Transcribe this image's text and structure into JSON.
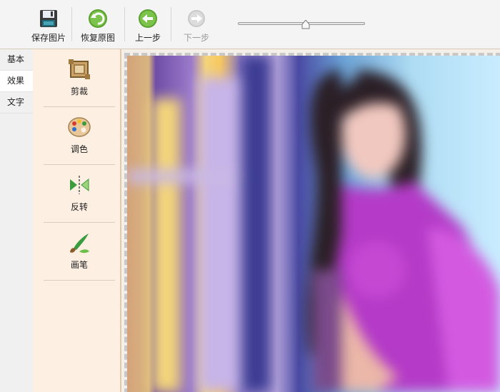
{
  "toolbar": {
    "save_label": "保存图片",
    "restore_label": "恢复原图",
    "undo_label": "上一步",
    "redo_label": "下一步",
    "slider_value": 0.5
  },
  "side_tabs": [
    {
      "label": "基本"
    },
    {
      "label": "效果"
    },
    {
      "label": "文字"
    }
  ],
  "tools": [
    {
      "label": "剪裁",
      "icon": "crop-icon"
    },
    {
      "label": "调色",
      "icon": "palette-icon"
    },
    {
      "label": "反转",
      "icon": "flip-icon"
    },
    {
      "label": "画笔",
      "icon": "brush-icon"
    }
  ],
  "colors": {
    "panel_bg": "#fdefe1",
    "toolbar_bg": "#f4f4f4",
    "accent_green": "#5aa12f"
  }
}
